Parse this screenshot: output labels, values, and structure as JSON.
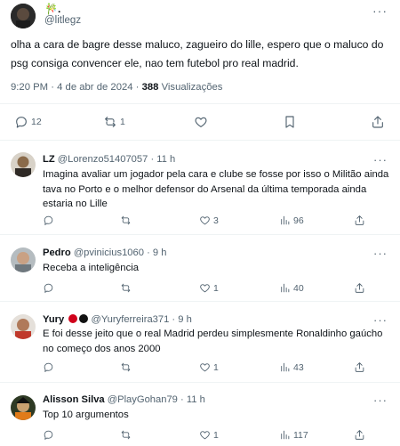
{
  "main_post": {
    "display_name": "🎋.",
    "handle": "@litlegz",
    "text": "olha a cara de bagre desse maluco, zagueiro do lille, espero que o maluco do psg consiga convencer ele, nao tem futebol pro real madrid.",
    "time": "9:20 PM · 4 de abr de 2024 · ",
    "views_count": "388",
    "views_label": " Visualizações",
    "more_icon": "···",
    "stats": {
      "replies": "12",
      "reposts": "1",
      "likes": "",
      "bookmarks": ""
    }
  },
  "replies": [
    {
      "name": "LZ",
      "handle": " @Lorenzo51407057",
      "time": " · 11 h",
      "text": "Imagina avaliar um jogador pela cara e clube se fosse por isso o Militão ainda tava no Porto e o melhor defensor do Arsenal da última temporada ainda estaria no Lille",
      "replies": "",
      "reposts": "",
      "likes": "3",
      "views": "96",
      "avatar_color": "#7a5a3a"
    },
    {
      "name": "Pedro",
      "handle": " @pvinicius1060",
      "time": " · 9 h",
      "text": "Receba a inteligência",
      "replies": "",
      "reposts": "",
      "likes": "1",
      "views": "40",
      "avatar_color": "#9aa3a9"
    },
    {
      "name": "Yury",
      "handle": " @Yuryferreira371",
      "time": " · 9 h",
      "text": "E foi desse jeito que o real Madrid perdeu simplesmente Ronaldinho gaúcho no começo dos anos 2000",
      "replies": "",
      "reposts": "",
      "likes": "1",
      "views": "43",
      "avatar_color": "#c0392b",
      "badges": [
        "#d0021b",
        "#111111"
      ]
    },
    {
      "name": "Alisson Silva",
      "handle": " @PlayGohan79",
      "time": " · 11 h",
      "text": "Top 10 argumentos",
      "replies": "",
      "reposts": "",
      "likes": "1",
      "views": "117",
      "avatar_color": "#3d4a2f"
    }
  ],
  "colors": {
    "text": "#0f1419",
    "secondary": "#536471",
    "divider": "#eff3f4"
  }
}
